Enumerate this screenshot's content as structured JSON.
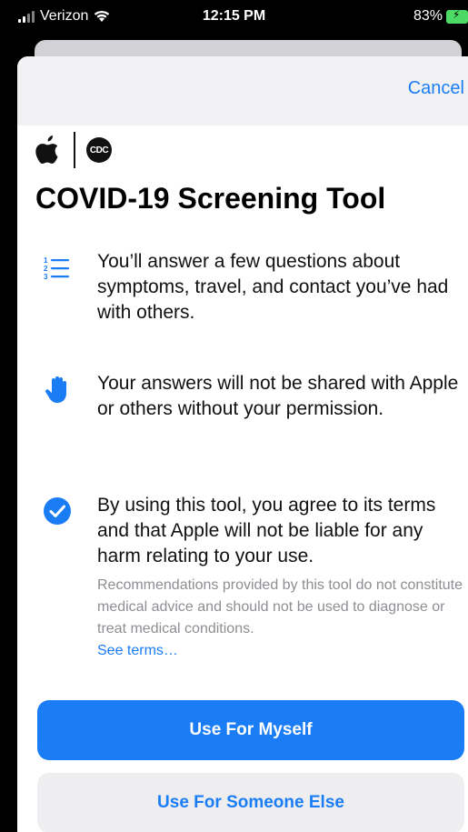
{
  "status_bar": {
    "carrier": "Verizon",
    "time": "12:15 PM",
    "battery_pct": "83%"
  },
  "nav": {
    "cancel_label": "Cancel"
  },
  "header": {
    "cdc_logo_text": "CDC"
  },
  "title": "COVID-19 Screening Tool",
  "items": [
    {
      "icon": "numbered-list-icon",
      "text": "You’ll answer a few questions about symptoms, travel, and contact you’ve had with others."
    },
    {
      "icon": "hand-icon",
      "text": "Your answers will not be shared with Apple or others without your permission."
    },
    {
      "icon": "checkmark-circle-icon",
      "text": "By using this tool, you agree to its terms and that Apple will not be liable for any harm relating to your use.",
      "subtext": "Recommendations provided by this tool do not constitute medical advice and should not be used to diagnose or treat medical conditions.",
      "link": "See terms…"
    }
  ],
  "buttons": {
    "primary": "Use For Myself",
    "secondary": "Use For Someone Else"
  },
  "colors": {
    "accent": "#1a7df5",
    "battery": "#4cd964",
    "secondary_text": "#8e8e93"
  }
}
